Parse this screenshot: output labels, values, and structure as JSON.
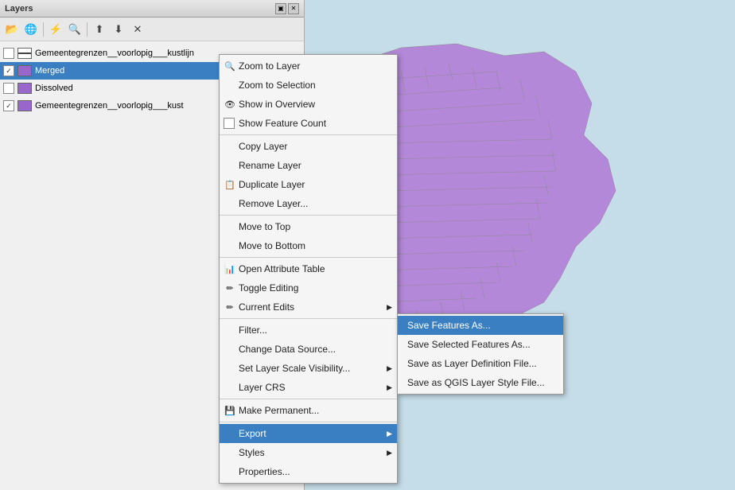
{
  "window": {
    "title": "Layers",
    "titlebar_buttons": [
      "restore",
      "close"
    ]
  },
  "toolbar": {
    "buttons": [
      {
        "name": "open-layer",
        "icon": "📂"
      },
      {
        "name": "add-layer",
        "icon": "➕"
      },
      {
        "name": "filter",
        "icon": "🔍"
      },
      {
        "name": "settings",
        "icon": "⚙"
      },
      {
        "name": "move-up",
        "icon": "↑"
      },
      {
        "name": "move-down",
        "icon": "↓"
      },
      {
        "name": "remove",
        "icon": "✕"
      }
    ]
  },
  "layers": [
    {
      "id": 1,
      "name": "Gemeentegrenzen__voorlopig___kustlijn",
      "type": "line",
      "checked": false,
      "selected": false
    },
    {
      "id": 2,
      "name": "Merged",
      "type": "polygon",
      "checked": true,
      "selected": true
    },
    {
      "id": 3,
      "name": "Dissolved",
      "type": "polygon",
      "checked": false,
      "selected": false
    },
    {
      "id": 4,
      "name": "Gemeentegrenzen__voorlopig___kust",
      "type": "polygon",
      "checked": true,
      "selected": false
    }
  ],
  "context_menu": {
    "items": [
      {
        "id": "zoom-to-layer",
        "label": "Zoom to Layer",
        "icon": "🔍",
        "type": "item",
        "shortcut": ""
      },
      {
        "id": "zoom-to-selection",
        "label": "Zoom to Selection",
        "icon": "🔍",
        "type": "item"
      },
      {
        "id": "show-in-overview",
        "label": "Show in Overview",
        "icon": "👁",
        "type": "item"
      },
      {
        "id": "show-feature-count",
        "label": "Show Feature Count",
        "icon": "",
        "type": "checkbox"
      },
      {
        "id": "sep1",
        "type": "separator"
      },
      {
        "id": "copy-layer",
        "label": "Copy Layer",
        "icon": "",
        "type": "item"
      },
      {
        "id": "rename-layer",
        "label": "Rename Layer",
        "icon": "",
        "type": "item"
      },
      {
        "id": "duplicate-layer",
        "label": "Duplicate Layer",
        "icon": "📋",
        "type": "item"
      },
      {
        "id": "remove-layer",
        "label": "Remove Layer...",
        "icon": "",
        "type": "item"
      },
      {
        "id": "sep2",
        "type": "separator"
      },
      {
        "id": "move-to-top",
        "label": "Move to Top",
        "icon": "",
        "type": "item"
      },
      {
        "id": "move-to-bottom",
        "label": "Move to Bottom",
        "icon": "",
        "type": "item"
      },
      {
        "id": "sep3",
        "type": "separator"
      },
      {
        "id": "open-attribute-table",
        "label": "Open Attribute Table",
        "icon": "📊",
        "type": "item"
      },
      {
        "id": "toggle-editing",
        "label": "Toggle Editing",
        "icon": "✏",
        "type": "item"
      },
      {
        "id": "current-edits",
        "label": "Current Edits",
        "icon": "✏",
        "type": "item",
        "submenu": true
      },
      {
        "id": "sep4",
        "type": "separator"
      },
      {
        "id": "filter",
        "label": "Filter...",
        "icon": "",
        "type": "item"
      },
      {
        "id": "change-data-source",
        "label": "Change Data Source...",
        "icon": "",
        "type": "item"
      },
      {
        "id": "set-layer-scale",
        "label": "Set Layer Scale Visibility...",
        "icon": "",
        "type": "item"
      },
      {
        "id": "layer-crs",
        "label": "Layer CRS",
        "icon": "",
        "type": "item",
        "submenu": true
      },
      {
        "id": "sep5",
        "type": "separator"
      },
      {
        "id": "make-permanent",
        "label": "Make Permanent...",
        "icon": "💾",
        "type": "item"
      },
      {
        "id": "sep6",
        "type": "separator"
      },
      {
        "id": "export",
        "label": "Export",
        "icon": "",
        "type": "item",
        "submenu": true,
        "highlighted": true
      },
      {
        "id": "styles",
        "label": "Styles",
        "icon": "",
        "type": "item",
        "submenu": true
      },
      {
        "id": "properties",
        "label": "Properties...",
        "icon": "",
        "type": "item"
      }
    ]
  },
  "export_submenu": {
    "items": [
      {
        "id": "save-features-as",
        "label": "Save Features As...",
        "highlighted": true
      },
      {
        "id": "save-selected-features-as",
        "label": "Save Selected Features As..."
      },
      {
        "id": "save-as-layer-def",
        "label": "Save as Layer Definition File..."
      },
      {
        "id": "save-as-qgis-style",
        "label": "Save as QGIS Layer Style File..."
      }
    ]
  }
}
